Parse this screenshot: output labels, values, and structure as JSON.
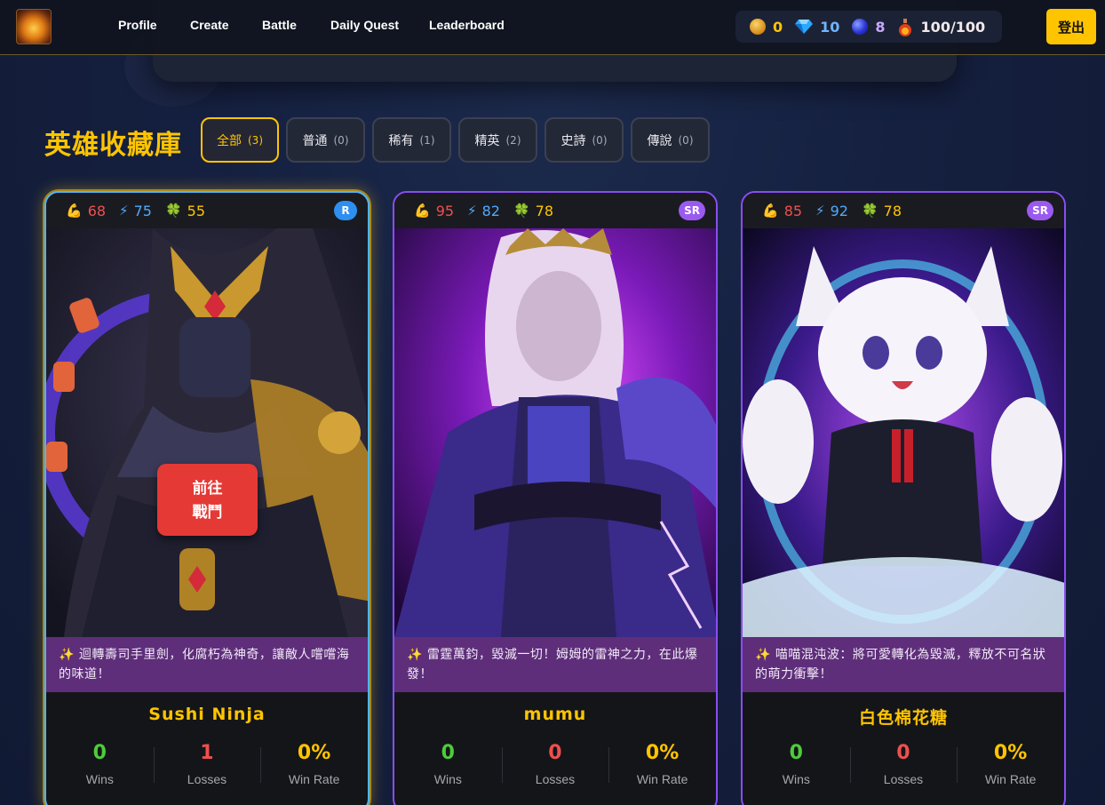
{
  "nav": {
    "links": [
      "Profile",
      "Create",
      "Battle",
      "Daily Quest",
      "Leaderboard"
    ],
    "logout_label": "登出"
  },
  "resources": {
    "coins": "0",
    "gems": "10",
    "orbs": "8",
    "energy": "100/100",
    "colors": {
      "coins": "#ffc400",
      "gems": "#6fb4ff",
      "orbs": "#c8a8ff",
      "energy": "#f0e8ea"
    }
  },
  "page": {
    "title": "英雄收藏庫",
    "filters": [
      {
        "label": "全部",
        "count": "(3)",
        "active": true
      },
      {
        "label": "普通",
        "count": "(0)",
        "active": false
      },
      {
        "label": "稀有",
        "count": "(1)",
        "active": false
      },
      {
        "label": "精英",
        "count": "(2)",
        "active": false
      },
      {
        "label": "史詩",
        "count": "(0)",
        "active": false
      },
      {
        "label": "傳說",
        "count": "(0)",
        "active": false
      }
    ]
  },
  "labels": {
    "wins": "Wins",
    "losses": "Losses",
    "win_rate": "Win Rate",
    "battle_button": [
      "前往",
      "戰鬥"
    ]
  },
  "heroes": [
    {
      "name": "Sushi Ninja",
      "rarity": "R",
      "strength": "68",
      "speed": "75",
      "luck": "55",
      "quote": "✨ 迴轉壽司手里劍，化腐朽為神奇，讓敵人嚐嚐海的味道！",
      "wins": "0",
      "losses": "1",
      "win_rate": "0%"
    },
    {
      "name": "mumu",
      "rarity": "SR",
      "strength": "95",
      "speed": "82",
      "luck": "78",
      "quote": "✨ 雷霆萬鈞，毀滅一切！姆姆的雷神之力，在此爆發！",
      "wins": "0",
      "losses": "0",
      "win_rate": "0%"
    },
    {
      "name": "白色棉花糖",
      "rarity": "SR",
      "strength": "85",
      "speed": "92",
      "luck": "78",
      "quote": "✨ 喵喵混沌波：將可愛轉化為毀滅，釋放不可名狀的萌力衝擊！",
      "wins": "0",
      "losses": "0",
      "win_rate": "0%"
    }
  ]
}
